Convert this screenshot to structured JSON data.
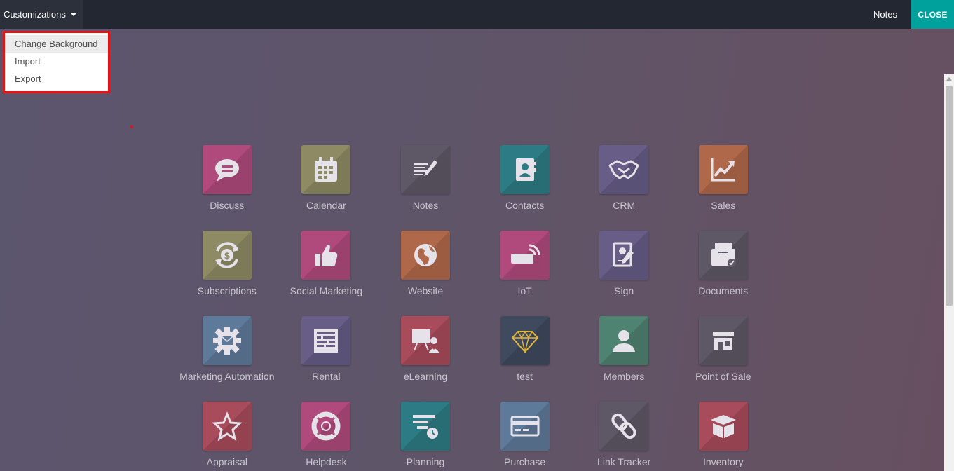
{
  "topbar": {
    "menu_label": "Customizations",
    "notes_label": "Notes",
    "close_label": "CLOSE"
  },
  "dropdown": {
    "items": [
      "Change Background",
      "Import",
      "Export"
    ]
  },
  "apps": [
    {
      "label": "Discuss",
      "icon": "chat-bubble-icon",
      "color": "#b04a7c"
    },
    {
      "label": "Calendar",
      "icon": "calendar-icon",
      "color": "#8e8b64"
    },
    {
      "label": "Notes",
      "icon": "notes-pen-icon",
      "color": "#5e5866"
    },
    {
      "label": "Contacts",
      "icon": "address-book-icon",
      "color": "#2d7b84"
    },
    {
      "label": "CRM",
      "icon": "handshake-icon",
      "color": "#675d86"
    },
    {
      "label": "Sales",
      "icon": "chart-up-icon",
      "color": "#b0684a"
    },
    {
      "label": "Subscriptions",
      "icon": "dollar-cycle-icon",
      "color": "#8e8b64"
    },
    {
      "label": "Social Marketing",
      "icon": "thumbs-up-icon",
      "color": "#b04a7c"
    },
    {
      "label": "Website",
      "icon": "globe-icon",
      "color": "#b0684a"
    },
    {
      "label": "IoT",
      "icon": "iot-signal-icon",
      "color": "#b04a7c"
    },
    {
      "label": "Sign",
      "icon": "sign-document-icon",
      "color": "#675d86"
    },
    {
      "label": "Documents",
      "icon": "documents-inbox-icon",
      "color": "#5e5866"
    },
    {
      "label": "Marketing Automation",
      "icon": "gear-mail-icon",
      "color": "#5e7a9a"
    },
    {
      "label": "Rental",
      "icon": "rental-grid-icon",
      "color": "#675d86"
    },
    {
      "label": "eLearning",
      "icon": "presentation-icon",
      "color": "#a84b5a"
    },
    {
      "label": "test",
      "icon": "diamond-icon",
      "color": "#3f4a5e"
    },
    {
      "label": "Members",
      "icon": "person-icon",
      "color": "#4e8271"
    },
    {
      "label": "Point of Sale",
      "icon": "shop-icon",
      "color": "#5e5866"
    },
    {
      "label": "Appraisal",
      "icon": "star-icon",
      "color": "#a84b5a"
    },
    {
      "label": "Helpdesk",
      "icon": "lifebuoy-icon",
      "color": "#b04a7c"
    },
    {
      "label": "Planning",
      "icon": "planning-clock-icon",
      "color": "#2d7b84"
    },
    {
      "label": "Purchase",
      "icon": "credit-card-icon",
      "color": "#5e7a9a"
    },
    {
      "label": "Link Tracker",
      "icon": "link-icon",
      "color": "#5e5866"
    },
    {
      "label": "Inventory",
      "icon": "box-icon",
      "color": "#a84b5a"
    }
  ]
}
